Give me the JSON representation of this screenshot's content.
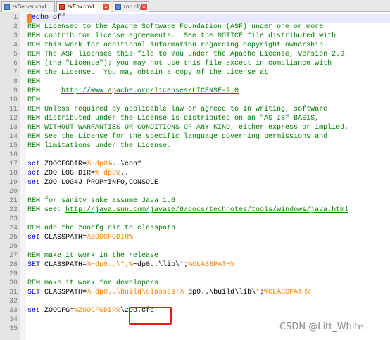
{
  "tabs": [
    {
      "label": "zkServer.cmd",
      "active": false,
      "closable": false
    },
    {
      "label": "zkEnv.cmd",
      "active": true,
      "closable": true
    },
    {
      "label": "zoo.cfg",
      "active": false,
      "closable": true
    }
  ],
  "line_numbers": [
    "1",
    "2",
    "3",
    "4",
    "5",
    "6",
    "7",
    "8",
    "9",
    "10",
    "11",
    "12",
    "13",
    "14",
    "15",
    "16",
    "17",
    "18",
    "19",
    "20",
    "21",
    "22",
    "23",
    "24",
    "25",
    "26",
    "27",
    "28",
    "29",
    "30",
    "31",
    "32",
    "33",
    "34",
    "35"
  ],
  "code_lines": [
    "@echo off",
    "REM Licensed to the Apache Software Foundation (ASF) under one or more",
    "REM contributor license agreements.  See the NOTICE file distributed with",
    "REM this work for additional information regarding copyright ownership.",
    "REM The ASF licenses this file to You under the Apache License, Version 2.0",
    "REM (the \"License\"); you may not use this file except in compliance with",
    "REM the License.  You may obtain a copy of the License at",
    "REM",
    "REM     http://www.apache.org/licenses/LICENSE-2.0",
    "REM",
    "REM Unless required by applicable law or agreed to in writing, software",
    "REM distributed under the License is distributed on an \"AS IS\" BASIS,",
    "REM WITHOUT WARRANTIES OR CONDITIONS OF ANY KIND, either express or implied.",
    "REM See the License for the specific language governing permissions and",
    "REM limitations under the License.",
    "",
    "set ZOOCFGDIR=%~dp0%..\\conf",
    "set ZOO_LOG_DIR=%~dp0%..",
    "set ZOO_LOG4J_PROP=INFO,CONSOLE",
    "",
    "REM for sanity sake assume Java 1.6",
    "REM see: http://java.sun.com/javase/6/docs/technotes/tools/windows/java.html",
    "",
    "REM add the zoocfg dir to classpath",
    "set CLASSPATH=%ZOOCFGDIR%",
    "",
    "REM make it work in the release",
    "SET CLASSPATH=%~dp0..\\*;%~dp0..\\lib\\*;%CLASSPATH%",
    "",
    "REM make it work for developers",
    "SET CLASSPATH=%~dp0..\\build\\classes;%~dp0..\\build\\lib\\*;%CLASSPATH%",
    "",
    "set ZOOCFG=%ZOOCFGDIR%\\zoo.cfg",
    "",
    ""
  ],
  "watermark": "CSDN @Litt_White",
  "colors": {
    "comment": "#008000",
    "keyword": "#0000ff",
    "variable": "#ff8000",
    "highlight_box": "#e41919",
    "gutter": "#e4e4e4"
  },
  "icons": [
    "file-icon",
    "close-icon"
  ]
}
